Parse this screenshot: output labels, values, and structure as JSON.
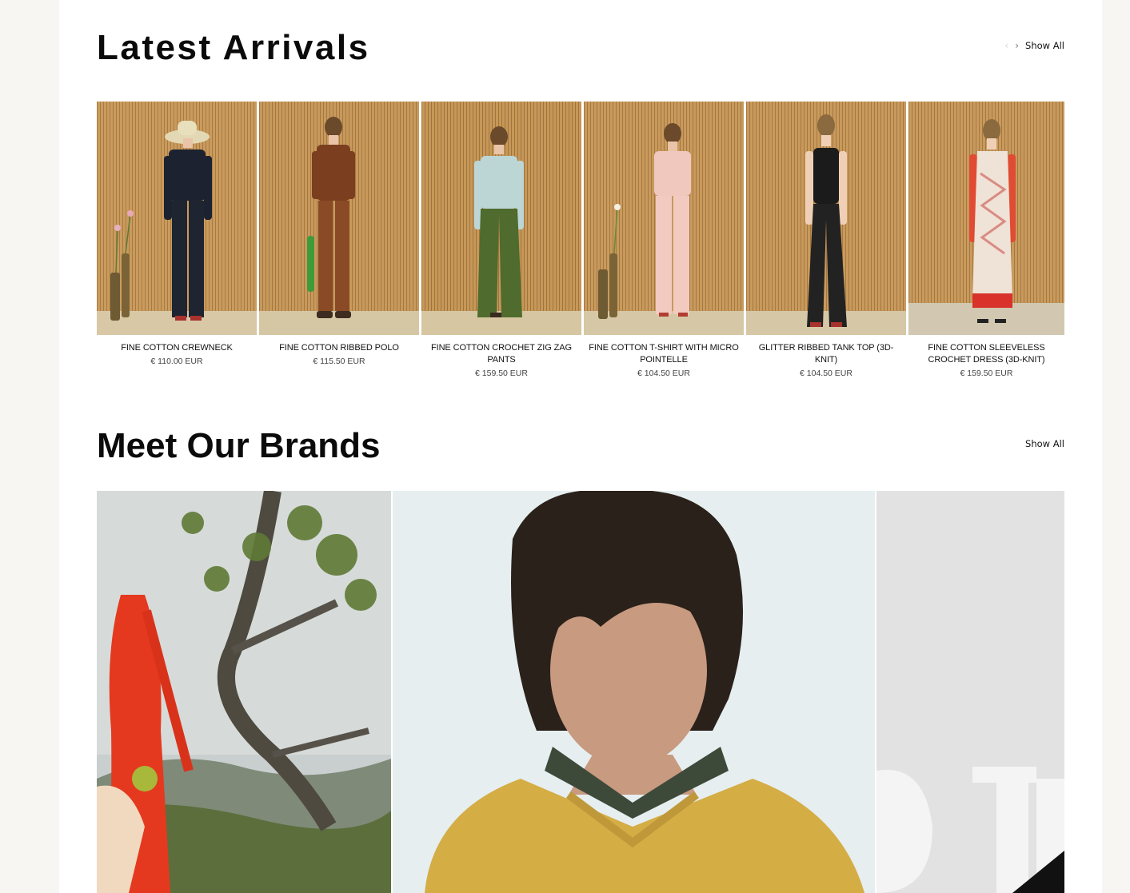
{
  "latest": {
    "title": "Latest Arrivals",
    "prev_icon": "chevron-left-icon",
    "next_icon": "chevron-right-icon",
    "show_all": "Show All"
  },
  "products": [
    {
      "name": "FINE COTTON CREWNECK",
      "price": "€ 110.00 EUR"
    },
    {
      "name": "FINE COTTON RIBBED POLO",
      "price": "€ 115.50 EUR"
    },
    {
      "name": "FINE COTTON CROCHET ZIG ZAG PANTS",
      "price": "€ 159.50 EUR"
    },
    {
      "name": "FINE COTTON T-SHIRT WITH MICRO POINTELLE",
      "price": "€ 104.50 EUR"
    },
    {
      "name": "GLITTER RIBBED TANK TOP (3D-KNIT)",
      "price": "€ 104.50 EUR"
    },
    {
      "name": "FINE COTTON SLEEVELESS CROCHET DRESS (3D-KNIT)",
      "price": "€ 159.50 EUR"
    }
  ],
  "brands": {
    "title": "Meet Our Brands",
    "show_all": "Show All"
  },
  "colors": {
    "page_bg": "#f7f6f2",
    "content_bg": "#ffffff",
    "wood": "#c89a5c"
  }
}
